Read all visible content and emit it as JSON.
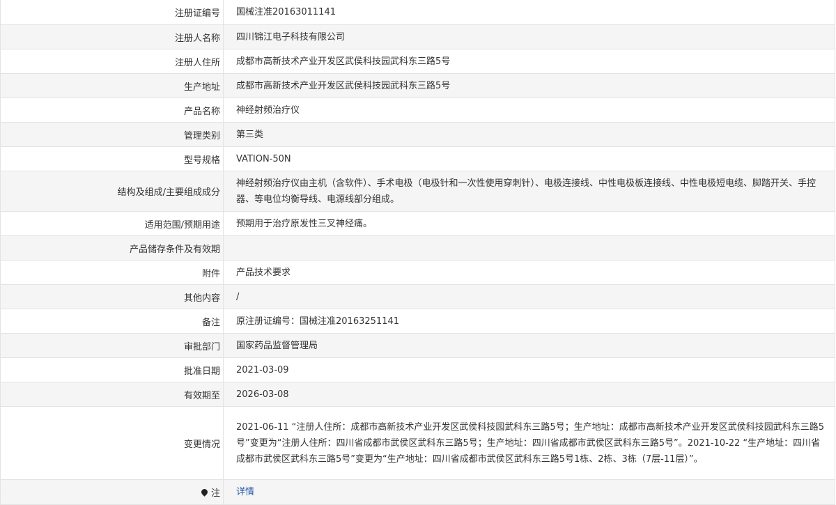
{
  "rows": [
    {
      "label": "注册证编号",
      "value": "国械注准20163011141"
    },
    {
      "label": "注册人名称",
      "value": "四川锦江电子科技有限公司"
    },
    {
      "label": "注册人住所",
      "value": "成都市高新技术产业开发区武侯科技园武科东三路5号"
    },
    {
      "label": "生产地址",
      "value": "成都市高新技术产业开发区武侯科技园武科东三路5号"
    },
    {
      "label": "产品名称",
      "value": "神经射频治疗仪"
    },
    {
      "label": "管理类别",
      "value": "第三类"
    },
    {
      "label": "型号规格",
      "value": "VATION-50N"
    },
    {
      "label": "结构及组成/主要组成成分",
      "value": "神经射频治疗仪由主机（含软件）、手术电极（电极针和一次性使用穿刺针）、电极连接线、中性电极板连接线、中性电极短电缆、脚踏开关、手控器、等电位均衡导线、电源线部分组成。"
    },
    {
      "label": "适用范围/预期用途",
      "value": "预期用于治疗原发性三叉神经痛。"
    },
    {
      "label": "产品储存条件及有效期",
      "value": ""
    },
    {
      "label": "附件",
      "value": "产品技术要求"
    },
    {
      "label": "其他内容",
      "value": "/"
    },
    {
      "label": "备注",
      "value": "原注册证编号：国械注准20163251141"
    },
    {
      "label": "审批部门",
      "value": "国家药品监督管理局"
    },
    {
      "label": "批准日期",
      "value": "2021-03-09"
    },
    {
      "label": "有效期至",
      "value": "2026-03-08"
    },
    {
      "label": "变更情况",
      "value": "2021-06-11 “注册人住所：成都市高新技术产业开发区武侯科技园武科东三路5号；生产地址：成都市高新技术产业开发区武侯科技园武科东三路5号”变更为“注册人住所：四川省成都市武侯区武科东三路5号；生产地址：四川省成都市武侯区武科东三路5号”。2021-10-22 “生产地址：四川省成都市武侯区武科东三路5号”变更为“生产地址：四川省成都市武侯区武科东三路5号1栋、2栋、3栋（7层-11层）”。"
    }
  ],
  "note": {
    "label": "注",
    "link": "详情"
  },
  "colors": {
    "border": "#e3e3e3",
    "stripe": "#f5f5f5",
    "link": "#2255aa"
  }
}
